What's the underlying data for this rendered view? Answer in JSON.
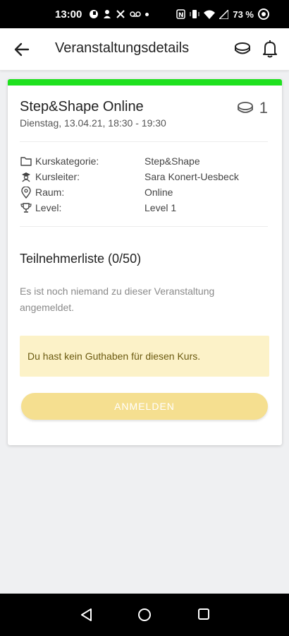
{
  "status_bar": {
    "time": "13:00",
    "battery": "73 %"
  },
  "app_bar": {
    "title": "Veranstaltungsdetails",
    "icons": [
      "back-arrow-icon",
      "coin-icon",
      "bell-icon"
    ]
  },
  "event": {
    "title": "Step&Shape Online",
    "date": "Dienstag, 13.04.21, 18:30 - 19:30",
    "credits": "1",
    "accent_color": "#1ee11e",
    "details": [
      {
        "icon": "folder-icon",
        "label": "Kurskategorie:",
        "value": "Step&Shape"
      },
      {
        "icon": "instructor-icon",
        "label": "Kursleiter:",
        "value": "Sara Konert-Uesbeck"
      },
      {
        "icon": "location-pin-icon",
        "label": "Raum:",
        "value": "Online"
      },
      {
        "icon": "trophy-icon",
        "label": "Level:",
        "value": "Level 1"
      }
    ]
  },
  "participants": {
    "title": "Teilnehmerliste (0/50)",
    "empty_text": "Es ist noch niemand zu dieser Veranstaltung angemeldet."
  },
  "alert": {
    "text": "Du hast kein Guthaben für diesen Kurs.",
    "background": "#fcf2c8"
  },
  "register_button": {
    "label": "ANMELDEN",
    "color": "#f5df90",
    "enabled": false
  }
}
